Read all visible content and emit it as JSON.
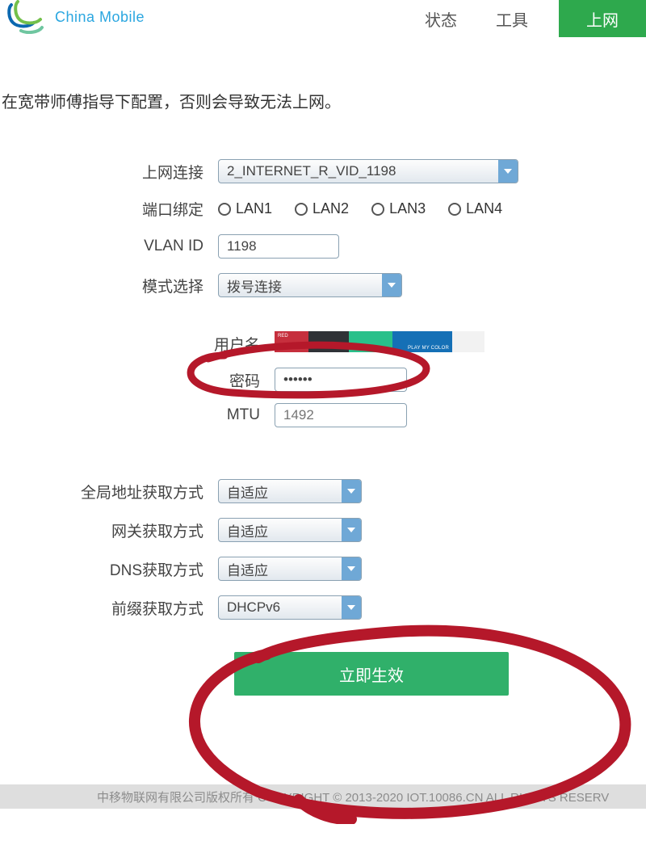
{
  "header": {
    "brand_text": "China Mobile",
    "tabs": {
      "status": "状态",
      "tools": "工具",
      "internet": "上网"
    }
  },
  "warning": "在宽带师傅指导下配置，否则会导致无法上网。",
  "labels": {
    "connection": "上网连接",
    "port_binding": "端口绑定",
    "vlan_id": "VLAN ID",
    "mode": "模式选择",
    "username": "用户名",
    "password": "密码",
    "mtu": "MTU",
    "global_addr": "全局地址获取方式",
    "gateway": "网关获取方式",
    "dns": "DNS获取方式",
    "prefix": "前缀获取方式"
  },
  "values": {
    "connection": "2_INTERNET_R_VID_1198",
    "vlan_id": "1198",
    "mode": "拨号连接",
    "password": "••••••",
    "mtu_placeholder": "1492",
    "global_addr": "自适应",
    "gateway": "自适应",
    "dns": "自适应",
    "prefix": "DHCPv6"
  },
  "ports": {
    "lan1": "LAN1",
    "lan2": "LAN2",
    "lan3": "LAN3",
    "lan4": "LAN4"
  },
  "apply": "立即生效",
  "footer": "中移物联网有限公司版权所有 COPYRIGHT © 2013-2020 IOT.10086.CN ALL RIGHTS RESERV"
}
